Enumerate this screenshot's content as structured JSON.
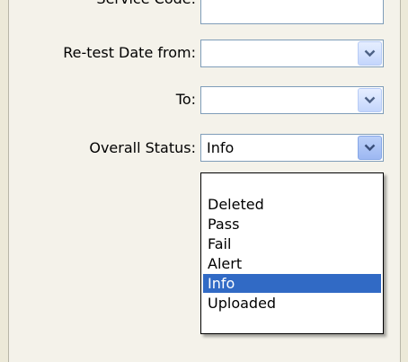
{
  "form": {
    "service_code_label": "Service Code:",
    "service_code_value": "",
    "retest_from_label": "Re-test Date from:",
    "retest_from_value": "",
    "retest_to_label": "To:",
    "retest_to_value": "",
    "overall_status_label": "Overall Status:",
    "overall_status_value": "Info"
  },
  "dropdown": {
    "options": [
      "",
      "Deleted",
      "Pass",
      "Fail",
      "Alert",
      "Info",
      "Uploaded"
    ],
    "selected": "Info"
  },
  "colors": {
    "selection": "#316ac5",
    "field_border": "#7f9db9"
  },
  "icons": {
    "combo_arrow": "chevron-down-icon"
  }
}
